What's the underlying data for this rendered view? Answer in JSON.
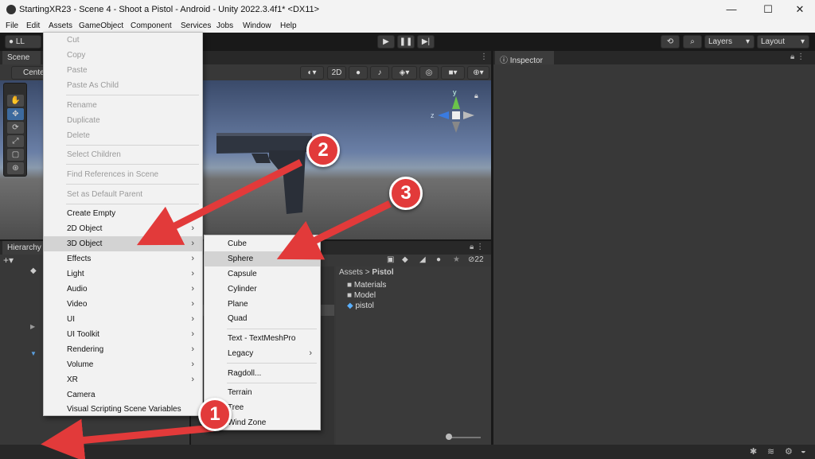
{
  "window": {
    "title": "StartingXR23 - Scene 4 - Shoot a Pistol - Android - Unity 2022.3.4f1* <DX11>",
    "minimize_glyph": "—",
    "maximize_glyph": "☐",
    "close_glyph": "✕"
  },
  "menubar": [
    "File",
    "Edit",
    "Assets",
    "GameObject",
    "Component",
    "Services",
    "Jobs",
    "Window",
    "Help"
  ],
  "toolbar": {
    "account": "LL",
    "layers": "Layers",
    "layout": "Layout",
    "play_glyph": "▶",
    "pause_glyph": "❚❚",
    "step_glyph": "▶|"
  },
  "scene": {
    "tab": "Scene",
    "pivot": "Center",
    "mode_2d": "2D",
    "gizmo_z": "z",
    "gizmo_y": "y"
  },
  "inspector": {
    "tab": "Inspector"
  },
  "hierarchy": {
    "tab": "Hierarchy"
  },
  "project": {
    "hidden_count": "22",
    "breadcrumb_root": "Assets",
    "breadcrumb_sep": ">",
    "breadcrumb_current": "Pistol",
    "items": [
      "Materials",
      "Model",
      "pistol"
    ]
  },
  "assets_menu": {
    "items": [
      {
        "label": "Cut",
        "disabled": true
      },
      {
        "label": "Copy",
        "disabled": true
      },
      {
        "label": "Paste",
        "disabled": true
      },
      {
        "label": "Paste As Child",
        "disabled": true
      },
      {
        "label": "Rename",
        "disabled": true
      },
      {
        "label": "Duplicate",
        "disabled": true
      },
      {
        "label": "Delete",
        "disabled": true
      },
      {
        "label": "Select Children",
        "disabled": true
      },
      {
        "label": "Find References in Scene",
        "disabled": true
      },
      {
        "label": "Set as Default Parent",
        "disabled": true
      },
      {
        "label": "Create Empty",
        "disabled": false
      },
      {
        "label": "2D Object",
        "disabled": false,
        "submenu": true
      },
      {
        "label": "3D Object",
        "disabled": false,
        "submenu": true,
        "highlight": true
      },
      {
        "label": "Effects",
        "disabled": false,
        "submenu": true
      },
      {
        "label": "Light",
        "disabled": false,
        "submenu": true
      },
      {
        "label": "Audio",
        "disabled": false,
        "submenu": true
      },
      {
        "label": "Video",
        "disabled": false,
        "submenu": true
      },
      {
        "label": "UI",
        "disabled": false,
        "submenu": true
      },
      {
        "label": "UI Toolkit",
        "disabled": false,
        "submenu": true
      },
      {
        "label": "Rendering",
        "disabled": false,
        "submenu": true
      },
      {
        "label": "Volume",
        "disabled": false,
        "submenu": true
      },
      {
        "label": "XR",
        "disabled": false,
        "submenu": true
      },
      {
        "label": "Camera",
        "disabled": false
      },
      {
        "label": "Visual Scripting Scene Variables",
        "disabled": false
      }
    ]
  },
  "submenu_3d": {
    "items": [
      {
        "label": "Cube"
      },
      {
        "label": "Sphere",
        "highlight": true
      },
      {
        "label": "Capsule"
      },
      {
        "label": "Cylinder"
      },
      {
        "label": "Plane"
      },
      {
        "label": "Quad"
      },
      {
        "label": "Text - TextMeshPro"
      },
      {
        "label": "Legacy",
        "submenu": true
      },
      {
        "label": "Ragdoll..."
      },
      {
        "label": "Terrain"
      },
      {
        "label": "Tree"
      },
      {
        "label": "Wind Zone"
      }
    ]
  },
  "annotations": {
    "badge_1": "1",
    "badge_2": "2",
    "badge_3": "3",
    "arrow_color": "#e23a3a"
  }
}
